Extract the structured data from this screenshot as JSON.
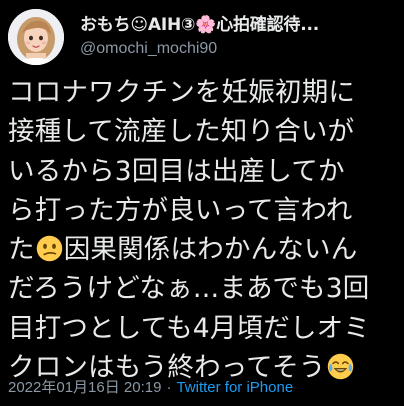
{
  "author": {
    "display_name": "おもち☺AIH③🌸心拍確認待...",
    "handle": "@omochi_mochi90"
  },
  "tweet": {
    "line1": "コロナワクチンを妊娠初期に",
    "line2": "接種して流産した知り合いが",
    "line3": "いるから3回目は出産してか",
    "line4": "ら打った方が良いって言われ",
    "line5a": "た",
    "line5b": "因果関係はわかんないん",
    "line6": "だろうけどなぁ…まあでも3回",
    "line7": "目打つとしても4月頃だしオミ",
    "line8": "クロンはもう終わってそう",
    "emoji_1": "confused-face",
    "emoji_2": "tears-of-joy-face"
  },
  "meta": {
    "timestamp": "2022年01月16日 20:19",
    "separator": "·",
    "source": "Twitter for iPhone"
  },
  "colors": {
    "background": "#000000",
    "text_primary": "#e7e9ea",
    "text_secondary": "#8b98a5",
    "link": "#1d9bf0"
  }
}
